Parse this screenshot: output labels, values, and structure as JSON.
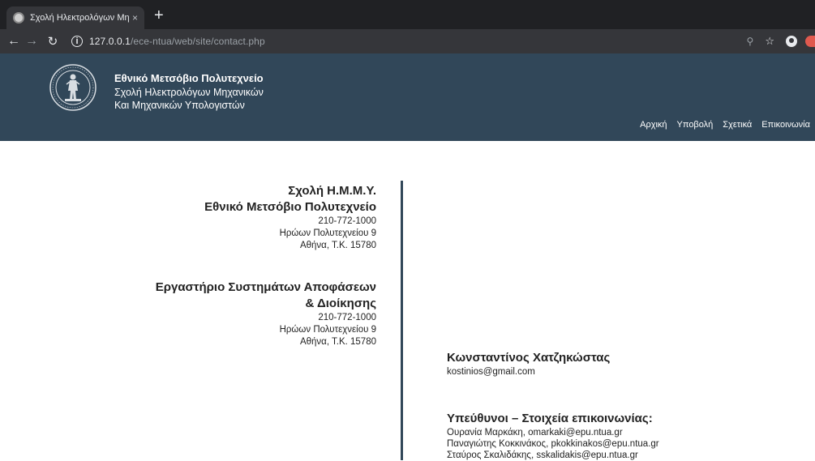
{
  "browser": {
    "tab_title": "Σχολή Ηλεκτρολόγων Μηχανικ",
    "tab_close": "×",
    "new_tab": "+",
    "url_host": "127.0.0.1",
    "url_path": "/ece-ntua/web/site/contact.php",
    "icons": [
      "back-icon",
      "forward-icon",
      "reload-icon",
      "info-icon",
      "zoom-icon",
      "star-icon",
      "profile-icon"
    ]
  },
  "header": {
    "line1": "Εθνικό Μετσόβιο Πολυτεχνείο",
    "line2": "Σχολή Ηλεκτρολόγων Μηχανικών",
    "line3": "Και Μηχανικών Υπολογιστών",
    "bg_color": "#314759"
  },
  "nav": {
    "home": "Αρχική",
    "submit": "Υποβολή",
    "about": "Σχετικά",
    "contact": "Επικοινωνία"
  },
  "school": {
    "title1": "Σχολή Η.Μ.Μ.Υ.",
    "title2": "Εθνικό Μετσόβιο Πολυτεχνείο",
    "phone": "210-772-1000",
    "street": "Ηρώων Πολυτεχνείου 9",
    "city": "Αθήνα, Τ.Κ. 15780"
  },
  "lab": {
    "title1": "Εργαστήριο Συστημάτων Αποφάσεων",
    "title2": "& Διοίκησης",
    "phone": "210-772-1000",
    "street": "Ηρώων Πολυτεχνείου 9",
    "city": "Αθήνα, Τ.Κ. 15780"
  },
  "author": {
    "name": "Κωνσταντίνος Χατζηκώστας",
    "email": "kostinios@gmail.com"
  },
  "responsible": {
    "title": "Υπεύθυνοι – Στοιχεία επικοινωνίας:",
    "people": [
      "Ουρανία Μαρκάκη, omarkaki@epu.ntua.gr",
      "Παναγιώτης Κοκκινάκος, pkokkinakos@epu.ntua.gr",
      "Σταύρος Σκαλιδάκης, sskalidakis@epu.ntua.gr"
    ]
  }
}
